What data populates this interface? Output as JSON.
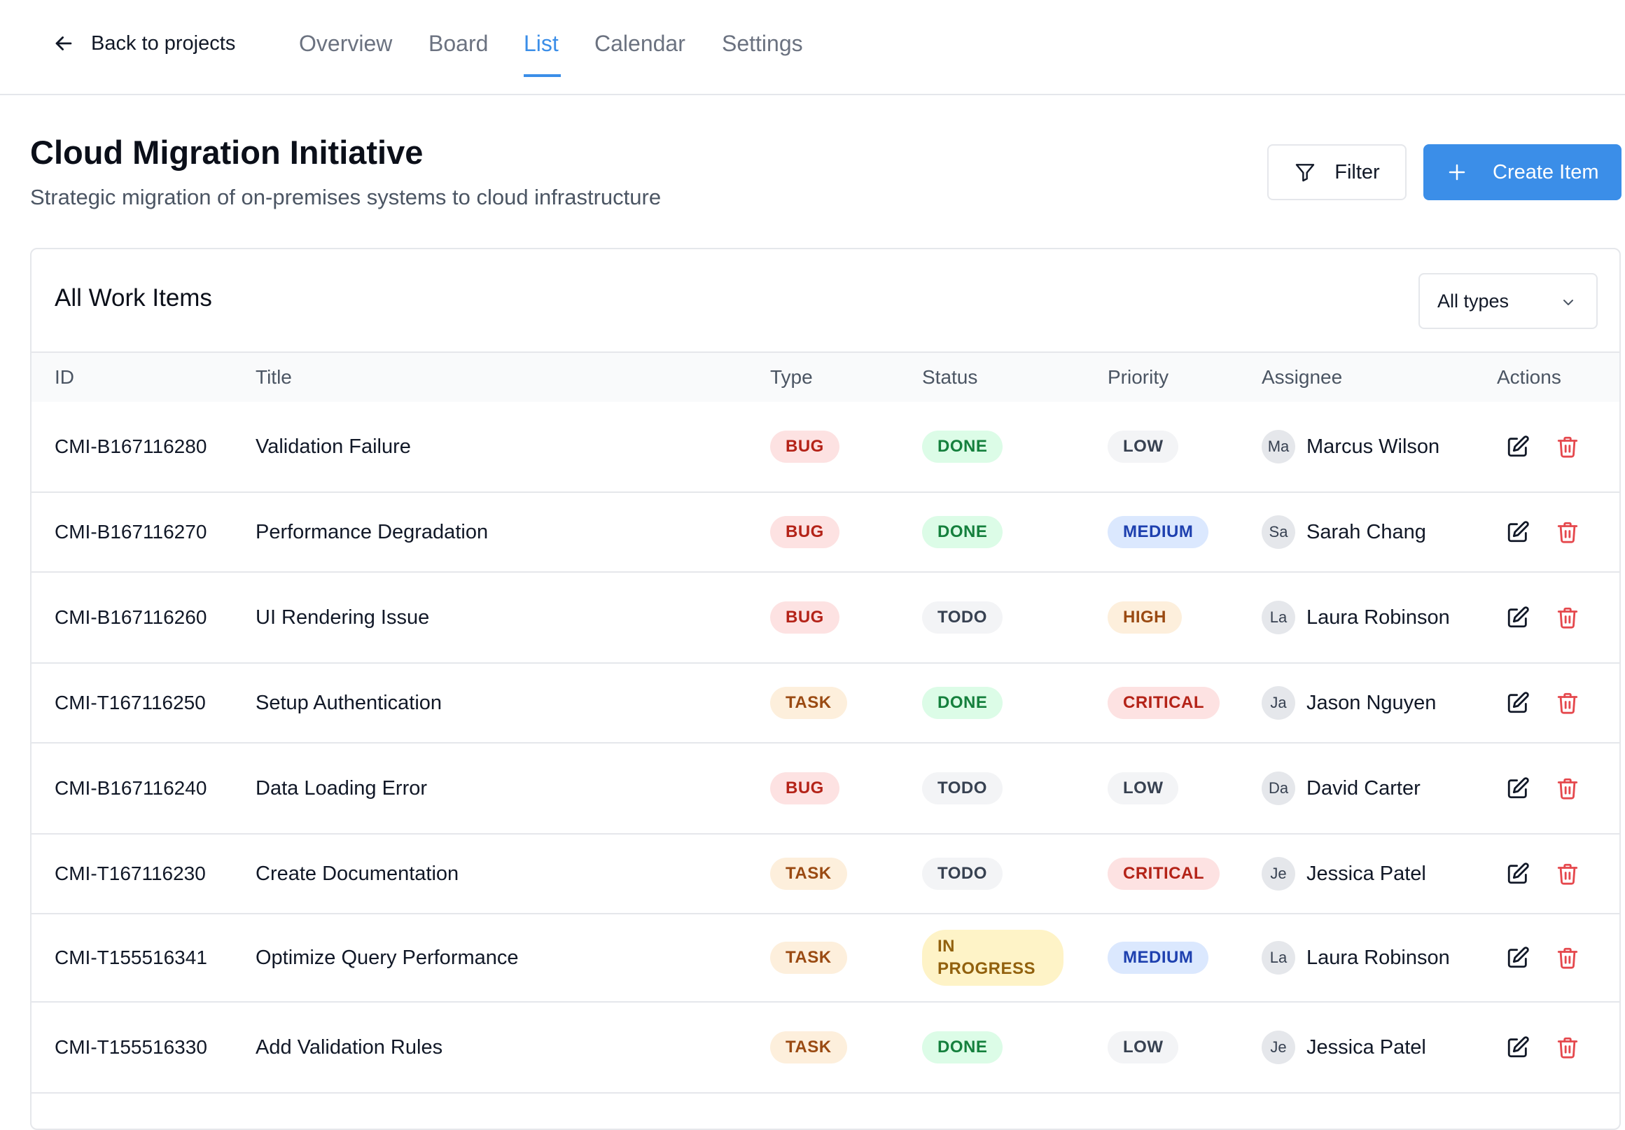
{
  "nav": {
    "back_label": "Back to projects",
    "tabs": [
      {
        "label": "Overview",
        "active": false
      },
      {
        "label": "Board",
        "active": false
      },
      {
        "label": "List",
        "active": true
      },
      {
        "label": "Calendar",
        "active": false
      },
      {
        "label": "Settings",
        "active": false
      }
    ]
  },
  "project": {
    "title": "Cloud Migration Initiative",
    "subtitle": "Strategic migration of on-premises systems to cloud infrastructure"
  },
  "toolbar": {
    "filter_label": "Filter",
    "create_label": "Create Item"
  },
  "work_items": {
    "heading": "All Work Items",
    "type_filter_value": "All types",
    "columns": [
      "ID",
      "Title",
      "Type",
      "Status",
      "Priority",
      "Assignee",
      "Actions"
    ],
    "rows": [
      {
        "id": "CMI-B167116280",
        "title": "Validation Failure",
        "type": "BUG",
        "status": "DONE",
        "priority": "LOW",
        "assignee_initials": "Ma",
        "assignee": "Marcus Wilson"
      },
      {
        "id": "CMI-B167116270",
        "title": "Performance Degradation",
        "type": "BUG",
        "status": "DONE",
        "priority": "MEDIUM",
        "assignee_initials": "Sa",
        "assignee": "Sarah Chang"
      },
      {
        "id": "CMI-B167116260",
        "title": "UI Rendering Issue",
        "type": "BUG",
        "status": "TODO",
        "priority": "HIGH",
        "assignee_initials": "La",
        "assignee": "Laura Robinson"
      },
      {
        "id": "CMI-T167116250",
        "title": "Setup Authentication",
        "type": "TASK",
        "status": "DONE",
        "priority": "CRITICAL",
        "assignee_initials": "Ja",
        "assignee": "Jason Nguyen"
      },
      {
        "id": "CMI-B167116240",
        "title": "Data Loading Error",
        "type": "BUG",
        "status": "TODO",
        "priority": "LOW",
        "assignee_initials": "Da",
        "assignee": "David Carter"
      },
      {
        "id": "CMI-T167116230",
        "title": "Create Documentation",
        "type": "TASK",
        "status": "TODO",
        "priority": "CRITICAL",
        "assignee_initials": "Je",
        "assignee": "Jessica Patel"
      },
      {
        "id": "CMI-T155516341",
        "title": "Optimize Query Performance",
        "type": "TASK",
        "status": "IN PROGRESS",
        "priority": "MEDIUM",
        "assignee_initials": "La",
        "assignee": "Laura Robinson"
      },
      {
        "id": "CMI-T155516330",
        "title": "Add Validation Rules",
        "type": "TASK",
        "status": "DONE",
        "priority": "LOW",
        "assignee_initials": "Je",
        "assignee": "Jessica Patel"
      }
    ]
  },
  "colors": {
    "accent": "#3b8ee8",
    "delete": "#e5484d",
    "bug_bg": "#fde2e2",
    "bug_fg": "#b42318",
    "task_bg": "#fdefdc",
    "task_fg": "#9a4a12",
    "done_bg": "#dcfce7",
    "done_fg": "#15803d",
    "todo_bg": "#f3f4f6",
    "todo_fg": "#374151",
    "inprogress_bg": "#fef3c7",
    "inprogress_fg": "#92610e",
    "low_bg": "#f3f4f6",
    "low_fg": "#374151",
    "medium_bg": "#dbe8fe",
    "medium_fg": "#1e40af",
    "high_bg": "#fdefdc",
    "high_fg": "#9a4a12",
    "critical_bg": "#fde2e2",
    "critical_fg": "#b42318"
  },
  "icons": {
    "back": "arrow-left-icon",
    "filter": "funnel-icon",
    "create": "plus-icon",
    "type_select": "chevron-down-icon",
    "edit": "edit-icon",
    "delete": "trash-icon"
  }
}
